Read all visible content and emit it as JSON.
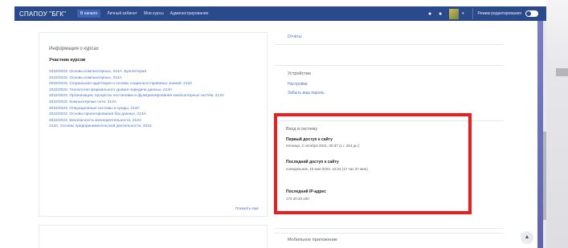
{
  "navbar": {
    "brand": "СПАПОУ \"БГК\"",
    "items": [
      {
        "label": "В начало",
        "active": true
      },
      {
        "label": "Личный кабинет",
        "active": false
      },
      {
        "label": "Мои курсы",
        "active": false
      },
      {
        "label": "Администрирование",
        "active": false
      }
    ],
    "icons": [
      "bell-icon",
      "chat-icon"
    ],
    "edit_mode_label": "Режим редактирования",
    "accent_color": "#2b4a8b"
  },
  "course_card": {
    "title": "Информация о курсах",
    "subheading": "Участник курсов",
    "courses": [
      "2022/2023. Основы компьютерных, 213А. Бухгалтерия",
      "2022/2023. Основы компьютерных, 213А",
      "2022/2023. Социальная адаптация и основы социально-правовых знаний, 213А",
      "2022/2023. Технология формального уровня передачи данных, 213А",
      "2022/2023. Организация, процессы постановки и функционирования компьютерных систем, 213А",
      "2022/2023. Компьютерные сети, 213А",
      "2022/2023. Операционные системы и среды, 213А",
      "2022/2023. Основы проектирования баз данных, 213А",
      "2022/2023. Безопасность жизнедеятельности, 213А",
      "213А. Основы предпринимательской деятельности, 2023"
    ],
    "show_more": "Показать ещё"
  },
  "right_column": {
    "reports_link": "Отчёты",
    "settings": {
      "title": "Устройства",
      "links": [
        "Настройки",
        "Забыть ваш пароль"
      ]
    },
    "login_activity": {
      "title": "Вход в систему",
      "first_access_label": "Первый доступ к сайту",
      "first_access_value": "пятница, 2 октября 2021, 00:37 (1 г. 204 дн.)",
      "last_access_label": "Последний доступ к сайту",
      "last_access_value": "понедельник, 15 мая 2023, 12:24 (17 час 37 мин)",
      "last_ip_label": "Последний IP-адрес",
      "last_ip_value": "172.20.20.100"
    },
    "mobile_app_title": "Мобильное приложение"
  },
  "highlight_color": "#ee1c1c"
}
